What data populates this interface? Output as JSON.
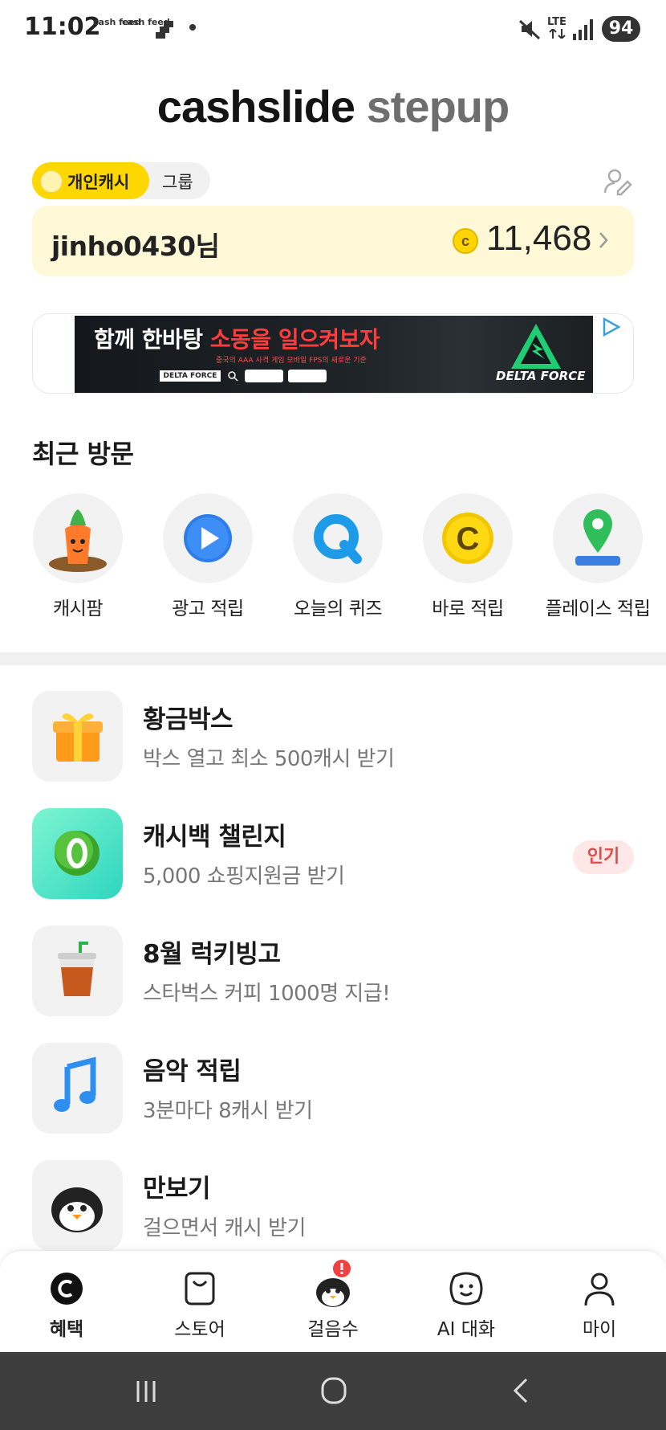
{
  "status_bar": {
    "time": "11:02",
    "notifications": [
      "cash feed",
      "cash feed"
    ],
    "network": "LTE",
    "battery": "94"
  },
  "app": {
    "logo_part1": "cashslide",
    "logo_part2": "stepup"
  },
  "mode_toggle": {
    "active": "개인캐시",
    "inactive": "그룹"
  },
  "user_card": {
    "username": "jinho0430님",
    "points": "11,468"
  },
  "banner": {
    "headline_white": "함께 한바탕 ",
    "headline_red": "소동을 일으켜보자",
    "sub": "중국의 AAA 사격 게임 모바일 FPS의 새로운 기준",
    "search_text": "DELTA FORCE",
    "logo_text": "DELTA FORCE"
  },
  "recent": {
    "title": "최근 방문",
    "items": [
      {
        "label": "캐시팜",
        "icon": "carrot-icon"
      },
      {
        "label": "광고 적립",
        "icon": "play-icon"
      },
      {
        "label": "오늘의 퀴즈",
        "icon": "quiz-q-icon"
      },
      {
        "label": "바로 적립",
        "icon": "coin-c-icon"
      },
      {
        "label": "플레이스 적립",
        "icon": "map-pin-icon"
      }
    ]
  },
  "list": [
    {
      "title": "황금박스",
      "subtitle": "박스 열고 최소 500캐시 받기",
      "icon": "gift-box-icon"
    },
    {
      "title": "캐시백 챌린지",
      "subtitle": "5,000 쇼핑지원금 받기",
      "icon": "cashback-ball-icon",
      "badge": "인기"
    },
    {
      "title": "8월 럭키빙고",
      "subtitle": "스타벅스 커피 1000명 지급!",
      "icon": "coffee-cup-icon"
    },
    {
      "title": "음악 적립",
      "subtitle": "3분마다 8캐시 받기",
      "icon": "music-note-icon"
    },
    {
      "title": "만보기",
      "subtitle": "걸으면서 캐시 받기",
      "icon": "penguin-icon"
    }
  ],
  "bottom_nav": [
    {
      "label": "혜택",
      "icon": "coin-c-icon",
      "active": true
    },
    {
      "label": "스토어",
      "icon": "shopping-bag-icon"
    },
    {
      "label": "걸음수",
      "icon": "penguin-icon"
    },
    {
      "label": "AI 대화",
      "icon": "chat-face-icon"
    },
    {
      "label": "마이",
      "icon": "person-icon"
    }
  ],
  "colors": {
    "brand_yellow": "#FFD700",
    "card_bg": "#FFF8D6",
    "popular_badge": "#E34A4A"
  }
}
